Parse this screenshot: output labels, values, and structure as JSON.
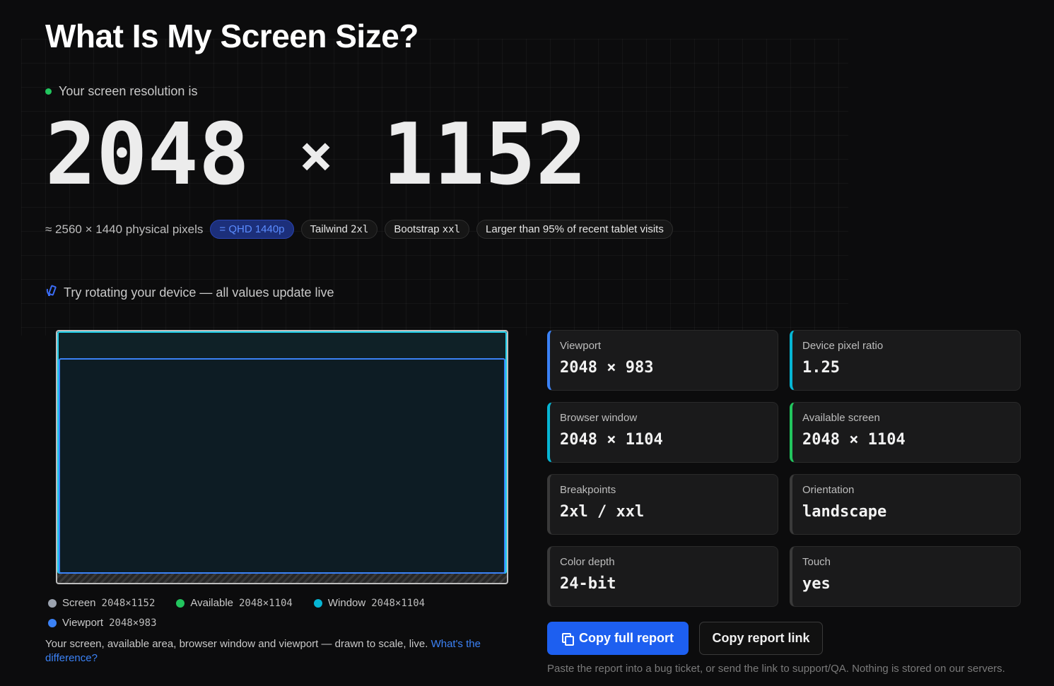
{
  "title": "What Is My Screen Size?",
  "status": "Your screen resolution is",
  "resolution": {
    "width": "2048",
    "times": "×",
    "height": "1152"
  },
  "meta": {
    "physical": "≈ 2560 × 1440 physical pixels",
    "tags": [
      {
        "label": "= QHD 1440p"
      },
      {
        "prefix": "Tailwind ",
        "mono": "2xl"
      },
      {
        "prefix": "Bootstrap ",
        "mono": "xxl"
      },
      {
        "prefix": "Larger than 95% of recent tablet visits",
        "mono": ""
      }
    ]
  },
  "rotate_hint": "Try rotating your device — all values update live",
  "legend": [
    {
      "label": "Screen",
      "value": "2048×1152",
      "color": "#9ca3af"
    },
    {
      "label": "Available",
      "value": "2048×1104",
      "color": "#22c55e"
    },
    {
      "label": "Window",
      "value": "2048×1104",
      "color": "#06b6d4"
    },
    {
      "label": "Viewport",
      "value": "2048×983",
      "color": "#3b82f6"
    }
  ],
  "caption": {
    "text": "Your screen, available area, browser window and viewport — drawn to scale, live. ",
    "link": "What's the difference?"
  },
  "cards": [
    {
      "label": "Viewport",
      "value": "2048 × 983",
      "accent": "#3b82f6"
    },
    {
      "label": "Device pixel ratio",
      "value": "1.25",
      "accent": "#06b6d4"
    },
    {
      "label": "Browser window",
      "value": "2048 × 1104",
      "accent": "#06b6d4"
    },
    {
      "label": "Available screen",
      "value": "2048 × 1104",
      "accent": "#22c55e"
    },
    {
      "label": "Breakpoints",
      "value": "2xl / xxl",
      "accent": "#3a3a3a"
    },
    {
      "label": "Orientation",
      "value": "landscape",
      "accent": "#3a3a3a"
    },
    {
      "label": "Color depth",
      "value": "24-bit",
      "accent": "#3a3a3a"
    },
    {
      "label": "Touch",
      "value": "yes",
      "accent": "#3a3a3a"
    }
  ],
  "actions": {
    "copy_report": "Copy full report",
    "copy_link": "Copy report link"
  },
  "footnote": "Paste the report into a bug ticket, or send the link to support/QA. Nothing is stored on our servers."
}
